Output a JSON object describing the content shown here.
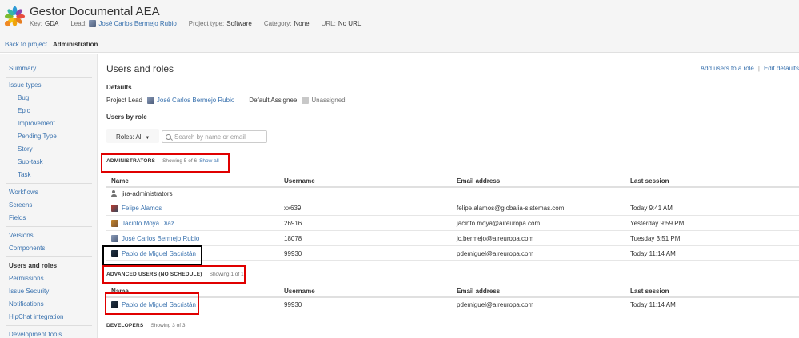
{
  "project": {
    "title": "Gestor Documental AEA",
    "key_label": "Key:",
    "key": "GDA",
    "lead_label": "Lead:",
    "lead": "José Carlos Bermejo Rubio",
    "type_label": "Project type:",
    "type": "Software",
    "category_label": "Category:",
    "category": "None",
    "url_label": "URL:",
    "url": "No URL"
  },
  "subnav": {
    "back": "Back to project",
    "current": "Administration"
  },
  "sidebar": {
    "summary": "Summary",
    "issue_types": "Issue types",
    "issue_type_items": [
      "Bug",
      "Epic",
      "Improvement",
      "Pending Type",
      "Story",
      "Sub-task",
      "Task"
    ],
    "workflows": "Workflows",
    "screens": "Screens",
    "fields": "Fields",
    "versions": "Versions",
    "components": "Components",
    "users_roles": "Users and roles",
    "permissions": "Permissions",
    "issue_security": "Issue Security",
    "notifications": "Notifications",
    "hipchat": "HipChat integration",
    "dev_tools": "Development tools"
  },
  "page": {
    "title": "Users and roles",
    "add_users": "Add users to a role",
    "separator": "|",
    "edit_defaults": "Edit defaults"
  },
  "defaults": {
    "heading": "Defaults",
    "lead_label": "Project Lead",
    "lead": "José Carlos Bermejo Rubio",
    "assignee_label": "Default Assignee",
    "assignee": "Unassigned"
  },
  "by_role": {
    "heading": "Users by role",
    "roles_filter": "Roles: All",
    "search_placeholder": "Search by name or email"
  },
  "columns": {
    "name": "Name",
    "username": "Username",
    "email": "Email address",
    "session": "Last session"
  },
  "administrators": {
    "title": "ADMINISTRATORS",
    "showing": "Showing 5 of 6",
    "show_all": "Show all",
    "group": "jira-administrators",
    "rows": [
      {
        "name": "Felipe Alamos",
        "username": "xx639",
        "email": "felipe.alamos@globalia-sistemas.com",
        "session": "Today 9:41 AM"
      },
      {
        "name": "Jacinto Moyá Díaz",
        "username": "26916",
        "email": "jacinto.moya@aireuropa.com",
        "session": "Yesterday 9:59 PM"
      },
      {
        "name": "José Carlos Bermejo Rubio",
        "username": "18078",
        "email": "jc.bermejo@aireuropa.com",
        "session": "Tuesday 3:51 PM"
      },
      {
        "name": "Pablo de Miguel Sacristán",
        "username": "99930",
        "email": "pdemiguel@aireuropa.com",
        "session": "Today 11:14 AM"
      }
    ]
  },
  "advanced": {
    "title": "ADVANCED USERS (NO SCHEDULE)",
    "showing": "Showing 1 of 1",
    "rows": [
      {
        "name": "Pablo de Miguel Sacristán",
        "username": "99930",
        "email": "pdemiguel@aireuropa.com",
        "session": "Today 11:14 AM"
      }
    ]
  },
  "developers": {
    "title": "DEVELOPERS",
    "showing": "Showing 3 of 3"
  },
  "colors": {
    "link": "#3b73af",
    "highlight": "#e00000",
    "highlight_alt": "#000000"
  }
}
